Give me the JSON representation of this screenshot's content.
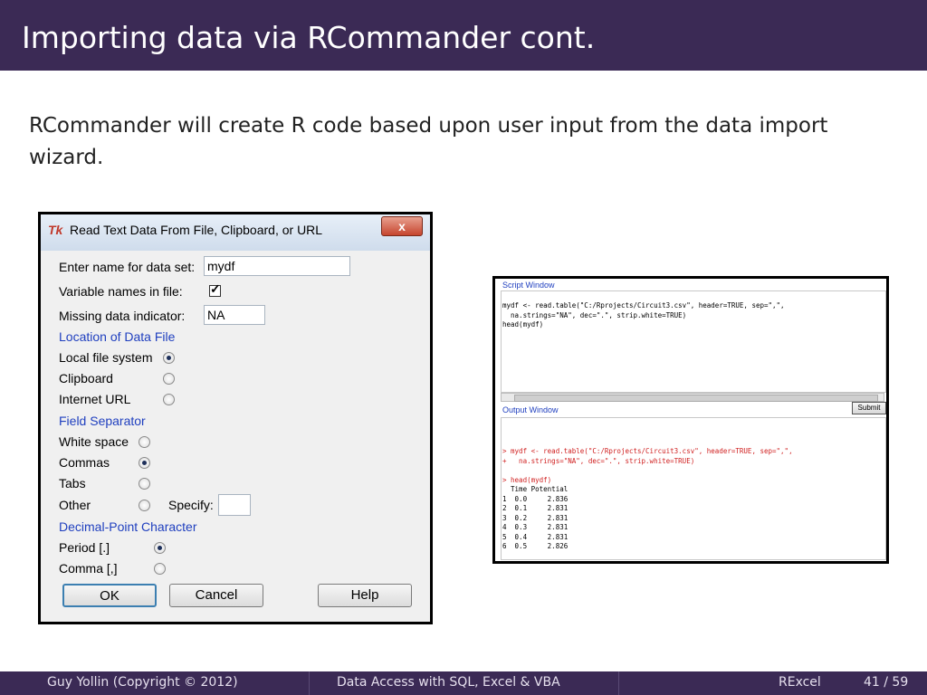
{
  "slide": {
    "title": "Importing data via RCommander cont.",
    "body": "RCommander will create R code based upon user input from the data import wizard."
  },
  "dialog": {
    "title": "Read Text Data From File, Clipboard, or URL",
    "icon_text": "Tk",
    "close_label": "x",
    "dataset_label": "Enter name for data set:",
    "dataset_value": "mydf",
    "varnames_label": "Variable names in file:",
    "varnames_checked": true,
    "missing_label": "Missing data indicator:",
    "missing_value": "NA",
    "location_section": "Location of Data File",
    "location_options": [
      "Local file system",
      "Clipboard",
      "Internet URL"
    ],
    "location_selected": "Local file system",
    "separator_section": "Field Separator",
    "separator_options": [
      "White space",
      "Commas",
      "Tabs",
      "Other"
    ],
    "separator_selected": "Commas",
    "specify_label": "Specify:",
    "specify_value": "",
    "decimal_section": "Decimal-Point Character",
    "decimal_options": [
      "Period [.]",
      "Comma [,]"
    ],
    "decimal_selected": "Period [.]",
    "ok_label": "OK",
    "cancel_label": "Cancel",
    "help_label": "Help"
  },
  "rwindow": {
    "script_title": "Script Window",
    "script_lines": [
      "mydf <- read.table(\"C:/Rprojects/Circuit3.csv\", header=TRUE, sep=\",\",",
      "  na.strings=\"NA\", dec=\".\", strip.white=TRUE)",
      "head(mydf)"
    ],
    "submit_label": "Submit",
    "output_title": "Output Window",
    "output_cmd_lines": [
      "> mydf <- read.table(\"C:/Rprojects/Circuit3.csv\", header=TRUE, sep=\",\",",
      "+   na.strings=\"NA\", dec=\".\", strip.white=TRUE)",
      "",
      "> head(mydf)"
    ],
    "output_result_lines": [
      "  Time Potential",
      "1  0.0     2.836",
      "2  0.1     2.831",
      "3  0.2     2.831",
      "4  0.3     2.831",
      "5  0.4     2.831",
      "6  0.5     2.826"
    ]
  },
  "footer": {
    "author": "Guy Yollin  (Copyright © 2012)",
    "course": "Data Access with SQL, Excel & VBA",
    "section": "RExcel",
    "page": "41 / 59"
  }
}
